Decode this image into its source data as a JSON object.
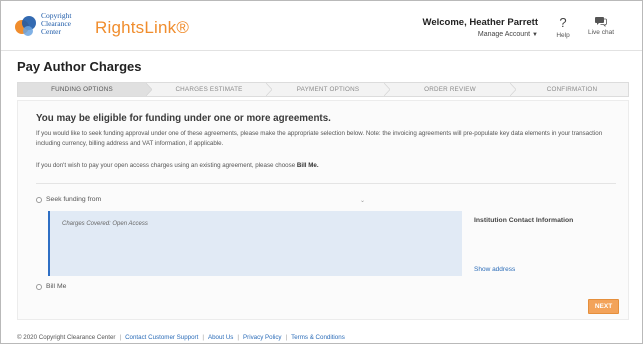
{
  "header": {
    "logo_lines": [
      "Copyright",
      "Clearance",
      "Center"
    ],
    "brand": "RightsLink®",
    "welcome": "Welcome, Heather Parrett",
    "manage_account": "Manage Account",
    "help_label": "Help",
    "chat_label": "Live chat"
  },
  "page_title": "Pay Author Charges",
  "steps": [
    {
      "label": "FUNDING OPTIONS",
      "active": true
    },
    {
      "label": "CHARGES ESTIMATE",
      "active": false
    },
    {
      "label": "PAYMENT OPTIONS",
      "active": false
    },
    {
      "label": "ORDER REVIEW",
      "active": false
    },
    {
      "label": "CONFIRMATION",
      "active": false
    }
  ],
  "content": {
    "heading": "You may be eligible for funding under one or more agreements.",
    "paragraph": "If you would like to seek funding approval under one of these agreements, please make the appropriate selection below. Note: the invoicing agreements will pre-populate key data elements in your transaction including currency, billing address and VAT information, if applicable.",
    "paragraph2_prefix": "If you don't wish to pay your open access charges using an existing agreement, please choose",
    "paragraph2_bold": "Bill Me.",
    "option_seek_funding": "Seek funding from",
    "charges_covered": "Charges Covered: Open Access",
    "institution_contact": "Institution Contact Information",
    "show_address": "Show address",
    "option_bill_me": "Bill Me",
    "next_button": "NEXT"
  },
  "footer": {
    "copyright": "© 2020 Copyright Clearance Center",
    "links": [
      "Contact Customer Support",
      "About Us",
      "Privacy Policy",
      "Terms & Conditions"
    ]
  },
  "colors": {
    "brand_orange": "#f08d2d",
    "link_blue": "#2b6cb8",
    "next_button": "#f3a35a",
    "agreement_bg": "#e1eaf5"
  }
}
